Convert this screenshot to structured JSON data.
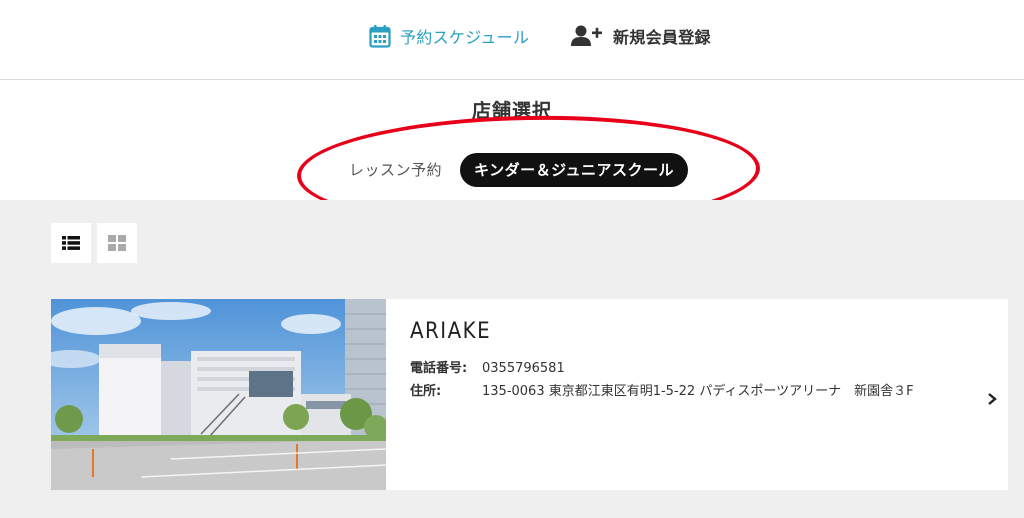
{
  "header": {
    "schedule_label": "予約スケジュール",
    "register_label": "新規会員登録",
    "schedule_color": "#2a9fc2"
  },
  "store_select": {
    "title": "店舗選択",
    "tabs": [
      {
        "label": "レッスン予約",
        "active": false
      },
      {
        "label": "キンダー＆ジュニアスクール",
        "active": true
      }
    ],
    "highlight_color": "#e8001a"
  },
  "view_toggle": {
    "list_icon": "list-view-icon",
    "grid_icon": "grid-view-icon"
  },
  "stores": [
    {
      "name": "ARIAKE",
      "tel_label": "電話番号:",
      "tel": "0355796581",
      "address_label": "住所:",
      "address": "135-0063 東京都江東区有明1-5-22 パディスポーツアリーナ　新園舎３F"
    }
  ]
}
